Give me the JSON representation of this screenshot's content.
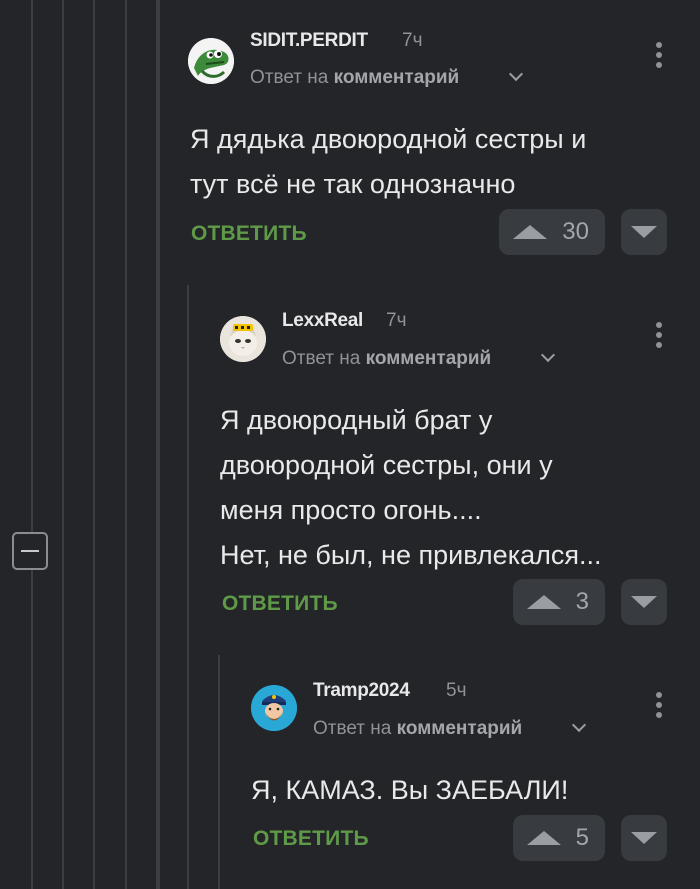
{
  "colors": {
    "background": "#232528",
    "reply_link": "#5f9a48",
    "muted": "#8f9296"
  },
  "comments": [
    {
      "author": "SIDIT.PERDIT",
      "time": "7ч",
      "reply_prefix": "Ответ на",
      "reply_target": "комментарий",
      "text_lines": [
        "Я дядька двоюродной сестры и",
        "тут всё не так однозначно"
      ],
      "reply_label": "ОТВЕТИТЬ",
      "score": "30",
      "avatar_icon": "snake-avatar-icon"
    },
    {
      "author": "LexxReal",
      "time": "7ч",
      "reply_prefix": "Ответ на",
      "reply_target": "комментарий",
      "text_lines": [
        "Я двоюродный брат у",
        "двоюродной сестры, они у",
        "меня просто огонь....",
        "Нет, не был, не привлекался..."
      ],
      "reply_label": "ОТВЕТИТЬ",
      "score": "3",
      "avatar_icon": "cat-taxi-avatar-icon"
    },
    {
      "author": "Tramp2024",
      "time": "5ч",
      "reply_prefix": "Ответ на",
      "reply_target": "комментарий",
      "text_lines": [
        "Я, КАМАЗ. Вы ЗАЕБАЛИ!"
      ],
      "reply_label": "ОТВЕТИТЬ",
      "score": "5",
      "avatar_icon": "bearded-officer-avatar-icon"
    }
  ]
}
